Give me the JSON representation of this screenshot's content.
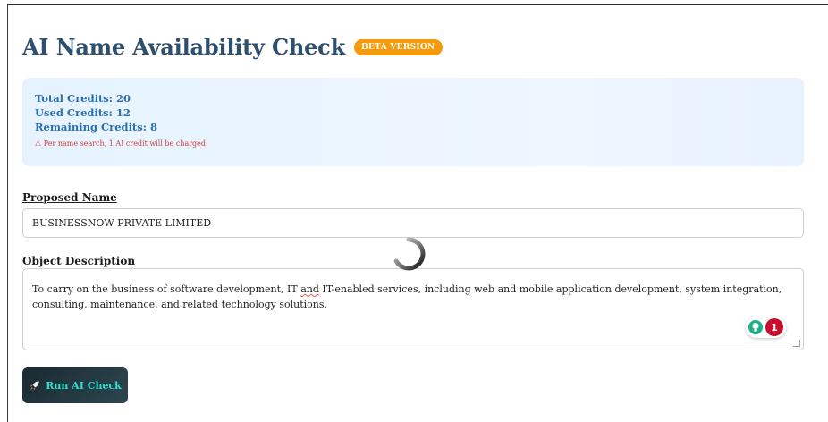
{
  "header": {
    "title": "AI Name Availability Check",
    "badge": "BETA VERSION"
  },
  "credits": {
    "total": "Total Credits: 20",
    "used": "Used Credits: 12",
    "remaining": "Remaining Credits: 8",
    "warning": "⚠ Per name search, 1 AI credit will be charged."
  },
  "form": {
    "proposed_name_label": "Proposed Name",
    "proposed_name_value": "BUSINESSNOW PRIVATE LIMITED",
    "object_description_label": "Object Description",
    "object_description_before": "To carry on the business of software development, IT ",
    "object_description_flag": "and",
    "object_description_after": " IT-enabled services, including web and mobile application development, system integration, consulting, maintenance, and related technology solutions."
  },
  "grammar_widget": {
    "count": "1",
    "icon": "lightbulb-icon"
  },
  "actions": {
    "run_label": "Run AI Check",
    "run_icon": "rocket-icon"
  },
  "colors": {
    "title": "#2f4f6f",
    "badge": "#f49a0b",
    "credit_text": "#2c6fb0",
    "warning": "#d23c3c",
    "button_text": "#33e0d0"
  }
}
